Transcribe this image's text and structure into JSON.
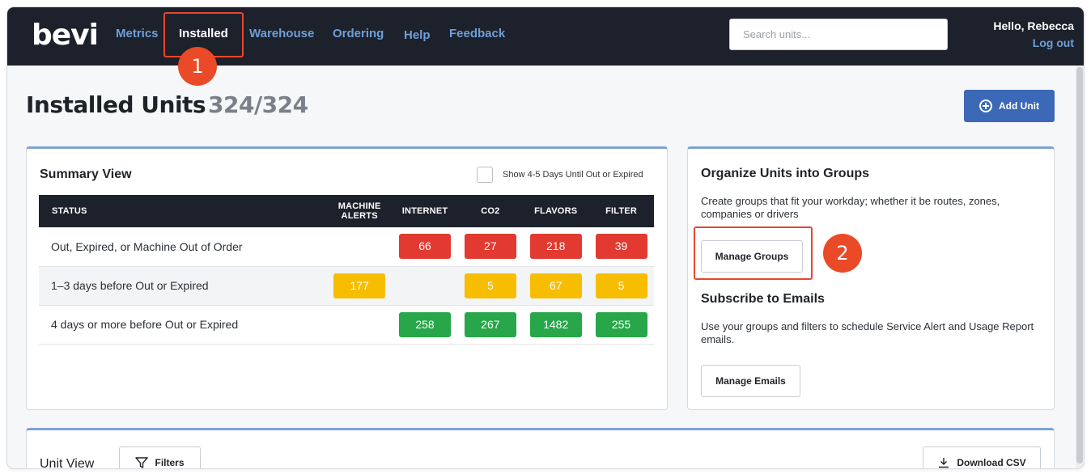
{
  "nav": {
    "logo": "bevi",
    "links": [
      {
        "label": "Metrics"
      },
      {
        "label": "Installed"
      },
      {
        "label": "Warehouse"
      },
      {
        "label": "Ordering"
      },
      {
        "label": "Help"
      },
      {
        "label": "Feedback"
      }
    ],
    "active": "Installed",
    "search_placeholder": "Search units...",
    "greeting": "Hello, Rebecca",
    "logout": "Log out"
  },
  "annotations": {
    "step1": "1",
    "step2": "2",
    "highlight_color": "#e8472c"
  },
  "header": {
    "title": "Installed Units",
    "count": "324/324",
    "add_unit": "Add Unit",
    "add_icon": "plus-circle-icon"
  },
  "summary": {
    "title": "Summary View",
    "checkbox_label": "Show 4-5 Days Until Out or Expired",
    "checkbox_checked": false,
    "columns": [
      "STATUS",
      "MACHINE\nALERTS",
      "INTERNET",
      "CO2",
      "FLAVORS",
      "FILTER"
    ],
    "rows": [
      {
        "label": "Out, Expired, or Machine Out of Order",
        "color": "red",
        "values": [
          "",
          "66",
          "27",
          "218",
          "39"
        ]
      },
      {
        "label": "1–3 days before Out or Expired",
        "color": "yellow",
        "values": [
          "177",
          "",
          "5",
          "67",
          "5"
        ]
      },
      {
        "label": "4 days or more before Out or Expired",
        "color": "green",
        "values": [
          "",
          "258",
          "267",
          "1482",
          "255"
        ]
      }
    ],
    "colors": {
      "red": "#e23a30",
      "yellow": "#f7bd00",
      "green": "#27a749"
    }
  },
  "groups": {
    "title": "Organize Units into Groups",
    "description": "Create groups that fit your workday; whether it be routes, zones, companies or drivers",
    "manage_groups": "Manage Groups",
    "subscribe_title": "Subscribe to Emails",
    "subscribe_description": "Use your groups and filters to schedule Service Alert and Usage Report emails.",
    "manage_emails": "Manage Emails"
  },
  "unit_view": {
    "title": "Unit View",
    "filters": "Filters",
    "filter_icon": "filter-icon",
    "download": "Download CSV",
    "download_icon": "download-icon"
  },
  "colors": {
    "nav_bg": "#1c212b",
    "nav_link": "#6f9fd8",
    "primary": "#3c69b7",
    "card_accent": "#7da3d6"
  }
}
